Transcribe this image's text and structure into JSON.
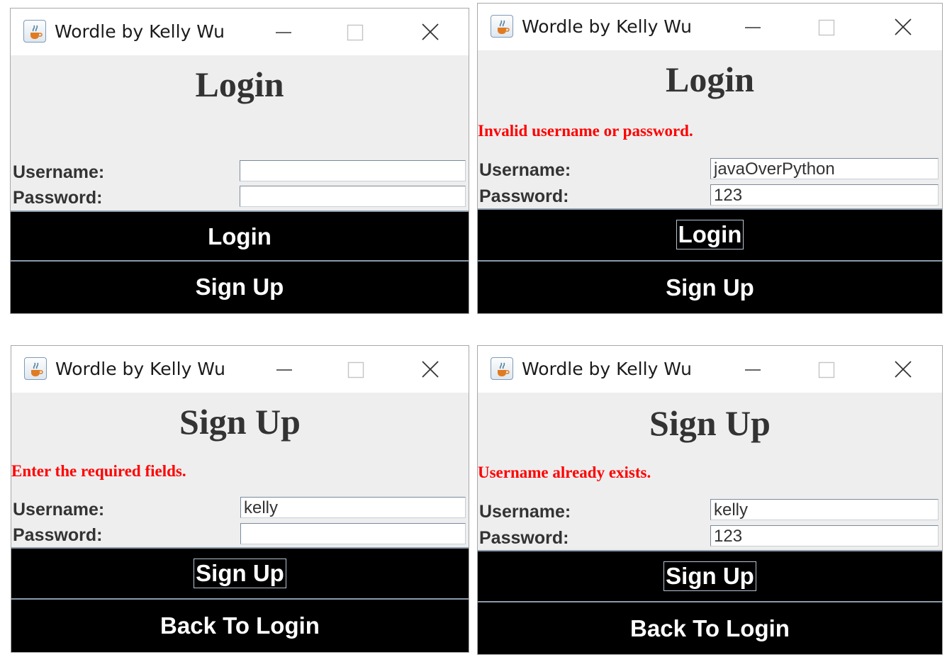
{
  "app": {
    "window_title": "Wordle by Kelly Wu",
    "icons": {
      "app": "java-cup-icon",
      "minimize": "minimize-icon",
      "maximize": "maximize-icon",
      "close": "close-icon"
    }
  },
  "panels": [
    {
      "heading": "Login",
      "error": "",
      "username_label": "Username:",
      "password_label": "Password:",
      "username_value": "",
      "password_value": "",
      "primary_button": "Login",
      "secondary_button": "Sign Up"
    },
    {
      "heading": "Login",
      "error": "Invalid username or password.",
      "username_label": "Username:",
      "password_label": "Password:",
      "username_value": "javaOverPython",
      "password_value": "123",
      "primary_button": "Login",
      "secondary_button": "Sign Up"
    },
    {
      "heading": "Sign Up",
      "error": "Enter the required fields.",
      "username_label": "Username:",
      "password_label": "Password:",
      "username_value": "kelly",
      "password_value": "",
      "primary_button": "Sign Up",
      "secondary_button": "Back To Login"
    },
    {
      "heading": "Sign Up",
      "error": "Username already exists.",
      "username_label": "Username:",
      "password_label": "Password:",
      "username_value": "kelly",
      "password_value": "123",
      "primary_button": "Sign Up",
      "secondary_button": "Back To Login"
    }
  ],
  "colors": {
    "error": "#ff0000",
    "button_bg": "#000000",
    "button_text": "#ffffff",
    "panel_bg": "#eeeeee",
    "heading": "#333333"
  }
}
